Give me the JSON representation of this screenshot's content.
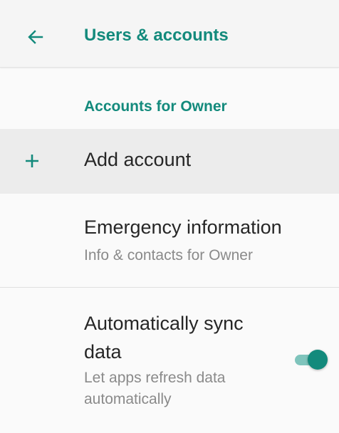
{
  "colors": {
    "accent": "#138a7c",
    "toggle_track": "#7fc4bc",
    "primary_text": "#262626",
    "secondary_text": "#8a8a8a",
    "app_bar_bg": "#f5f5f5",
    "highlight_row_bg": "#ececec"
  },
  "header": {
    "title": "Users & accounts",
    "back_icon": "arrow-back-icon"
  },
  "section": {
    "title": "Accounts for Owner"
  },
  "items": [
    {
      "icon": "plus-icon",
      "title": "Add account"
    },
    {
      "title": "Emergency information",
      "subtitle": "Info & contacts for Owner"
    },
    {
      "title": "Automatically sync data",
      "subtitle": "Let apps refresh data automatically",
      "toggle_state": "on"
    }
  ]
}
